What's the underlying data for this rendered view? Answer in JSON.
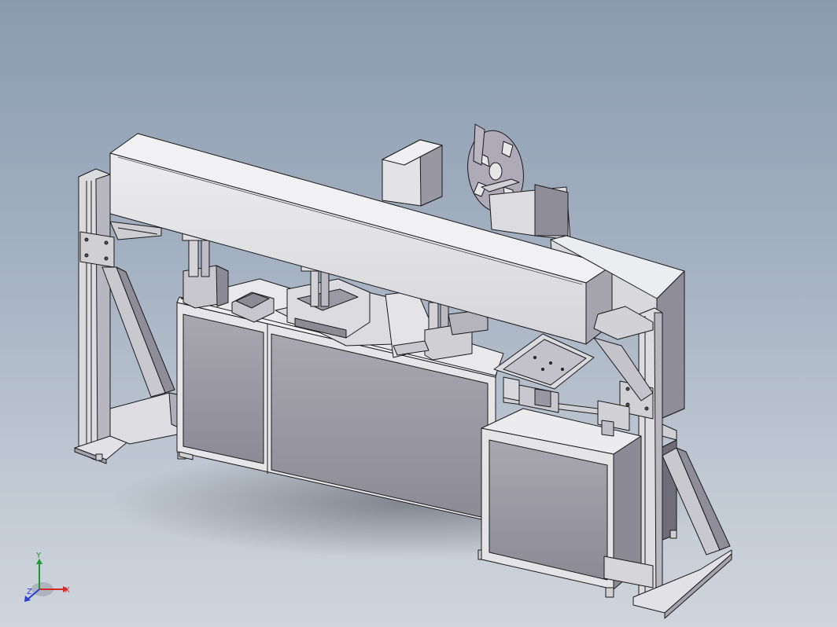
{
  "viewport": {
    "background_top": "#8a9bb0",
    "background_bottom": "#cfd5dc"
  },
  "model": {
    "part_fill": "#e3e3e6",
    "part_shade": "#9a99a4",
    "part_dark": "#6e6d78",
    "edge_color": "#1a1a1a",
    "reel_fill": "#aeaab7"
  },
  "triad": {
    "x_label": "X",
    "y_label": "Y",
    "z_label": "Z",
    "x_color": "#d42a2a",
    "y_color": "#1c9a2c",
    "z_color": "#2a3ed4"
  }
}
